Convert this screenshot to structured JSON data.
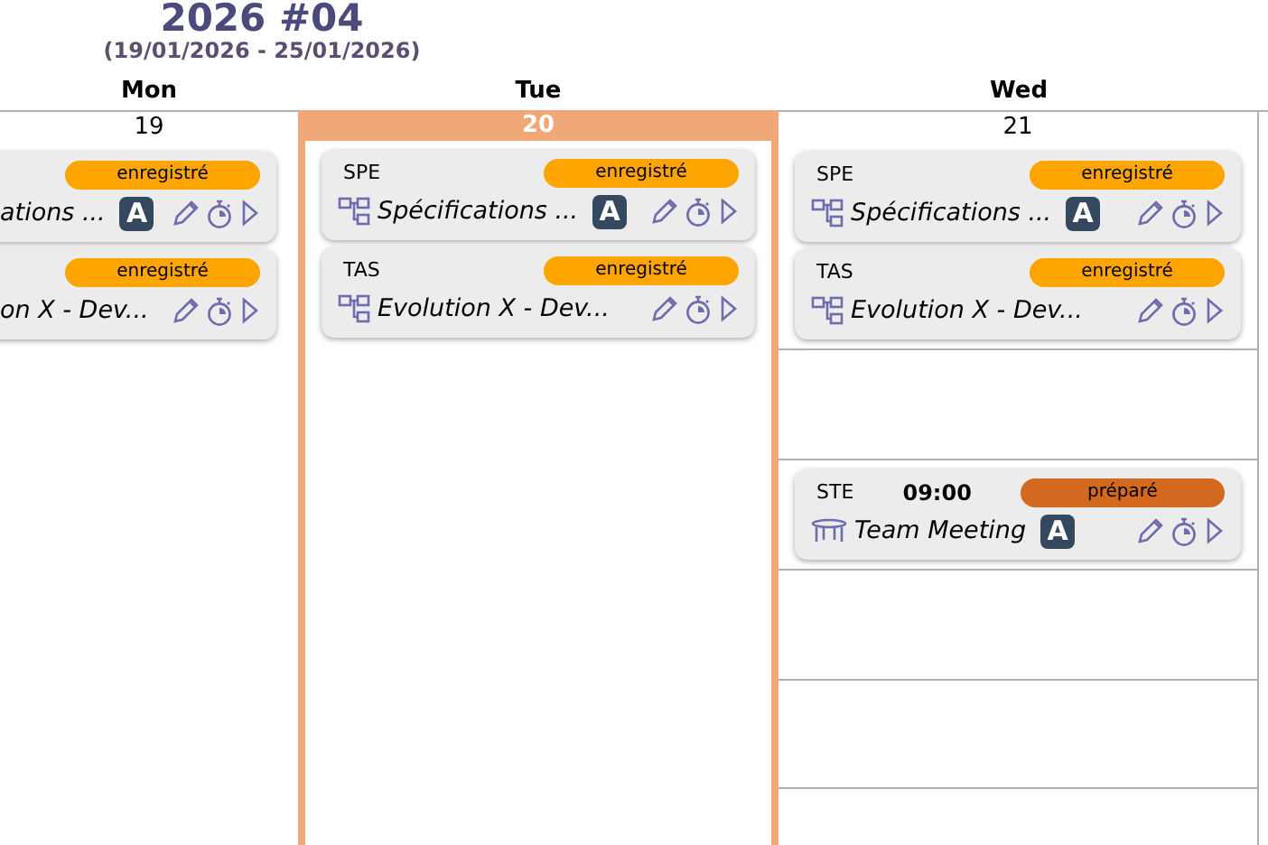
{
  "week": {
    "title": "2026 #04",
    "range": "(19/01/2026 - 25/01/2026)"
  },
  "days": [
    {
      "name": "Mon",
      "number": "19",
      "selected": false,
      "cards": [
        {
          "kind": "partial",
          "status": {
            "label": "enregistré",
            "color": "#ffa500"
          },
          "title": "ations ...",
          "badge": "A"
        },
        {
          "kind": "partial",
          "status": {
            "label": "enregistré",
            "color": "#ffa500"
          },
          "title": "on X - Dev..."
        }
      ]
    },
    {
      "name": "Tue",
      "number": "20",
      "selected": true,
      "cards": [
        {
          "kind": "task",
          "code": "SPE",
          "status": {
            "label": "enregistré",
            "color": "#ffa500"
          },
          "title": "Spécifications ...",
          "badge": "A"
        },
        {
          "kind": "task",
          "code": "TAS",
          "status": {
            "label": "enregistré",
            "color": "#ffa500"
          },
          "title": "Evolution X - Dev..."
        }
      ]
    },
    {
      "name": "Wed",
      "number": "21",
      "selected": false,
      "cards": [
        {
          "kind": "task",
          "code": "SPE",
          "status": {
            "label": "enregistré",
            "color": "#ffa500"
          },
          "title": "Spécifications ...",
          "badge": "A"
        },
        {
          "kind": "task",
          "code": "TAS",
          "status": {
            "label": "enregistré",
            "color": "#ffa500"
          },
          "title": "Evolution X - Dev..."
        }
      ],
      "slots": [
        {
          "kind": "empty"
        },
        {
          "kind": "event",
          "card": {
            "kind": "meeting",
            "code": "STE",
            "time": "09:00",
            "status": {
              "label": "préparé",
              "color": "#d2691e"
            },
            "title": "Team Meeting",
            "badge": "A"
          }
        },
        {
          "kind": "empty"
        },
        {
          "kind": "empty"
        }
      ]
    }
  ]
}
